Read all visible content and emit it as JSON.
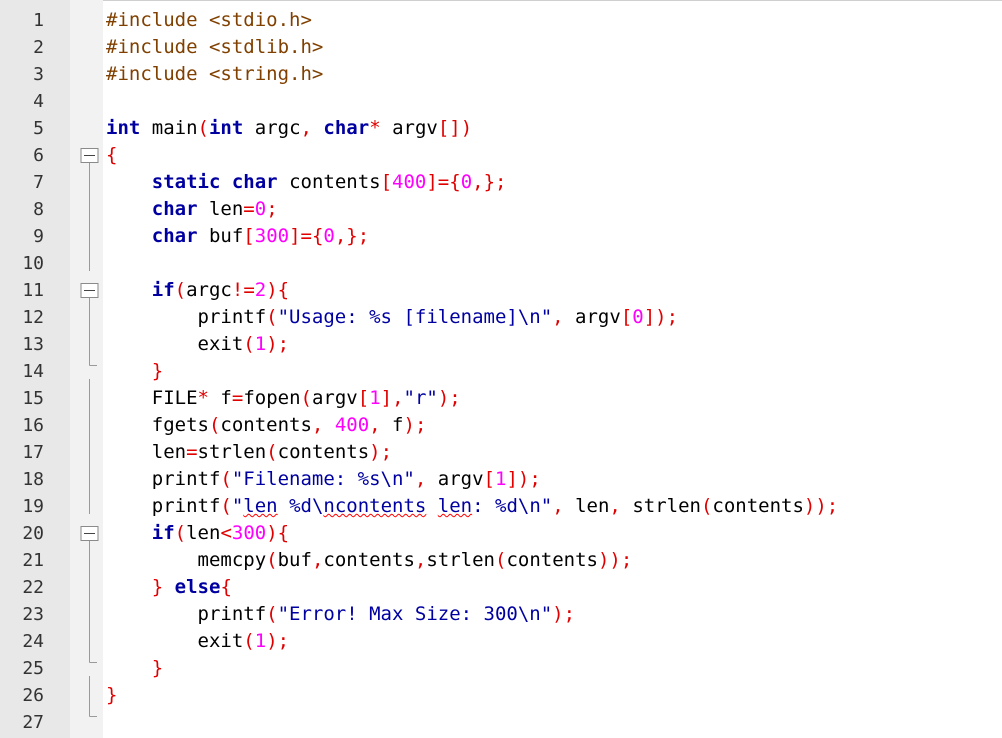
{
  "editor": {
    "lines": [
      {
        "n": "1",
        "fold": null,
        "tokens": [
          [
            "pp",
            "#include <stdio.h>"
          ]
        ]
      },
      {
        "n": "2",
        "fold": null,
        "tokens": [
          [
            "pp",
            "#include <stdlib.h>"
          ]
        ]
      },
      {
        "n": "3",
        "fold": null,
        "tokens": [
          [
            "pp",
            "#include <string.h>"
          ]
        ]
      },
      {
        "n": "4",
        "fold": null,
        "tokens": []
      },
      {
        "n": "5",
        "fold": null,
        "tokens": [
          [
            "kw",
            "int"
          ],
          [
            "id",
            " main"
          ],
          [
            "op",
            "("
          ],
          [
            "kw",
            "int"
          ],
          [
            "id",
            " argc"
          ],
          [
            "op",
            ","
          ],
          [
            "id",
            " "
          ],
          [
            "kw",
            "char"
          ],
          [
            "op",
            "*"
          ],
          [
            "id",
            " argv"
          ],
          [
            "op",
            "[])"
          ]
        ]
      },
      {
        "n": "6",
        "fold": "open",
        "tokens": [
          [
            "op",
            "{"
          ]
        ]
      },
      {
        "n": "7",
        "fold": "line",
        "tokens": [
          [
            "id",
            "    "
          ],
          [
            "kw",
            "static"
          ],
          [
            "id",
            " "
          ],
          [
            "kw",
            "char"
          ],
          [
            "id",
            " contents"
          ],
          [
            "op",
            "["
          ],
          [
            "num",
            "400"
          ],
          [
            "op",
            "]={"
          ],
          [
            "num",
            "0"
          ],
          [
            "op",
            ",};"
          ]
        ]
      },
      {
        "n": "8",
        "fold": "line",
        "tokens": [
          [
            "id",
            "    "
          ],
          [
            "kw",
            "char"
          ],
          [
            "id",
            " len"
          ],
          [
            "op",
            "="
          ],
          [
            "num",
            "0"
          ],
          [
            "op",
            ";"
          ]
        ]
      },
      {
        "n": "9",
        "fold": "line",
        "tokens": [
          [
            "id",
            "    "
          ],
          [
            "kw",
            "char"
          ],
          [
            "id",
            " buf"
          ],
          [
            "op",
            "["
          ],
          [
            "num",
            "300"
          ],
          [
            "op",
            "]={"
          ],
          [
            "num",
            "0"
          ],
          [
            "op",
            ",};"
          ]
        ]
      },
      {
        "n": "10",
        "fold": "line",
        "tokens": []
      },
      {
        "n": "11",
        "fold": "open",
        "tokens": [
          [
            "id",
            "    "
          ],
          [
            "kw",
            "if"
          ],
          [
            "op",
            "("
          ],
          [
            "id",
            "argc"
          ],
          [
            "op",
            "!="
          ],
          [
            "num",
            "2"
          ],
          [
            "op",
            ")"
          ],
          [
            "op",
            "{"
          ]
        ]
      },
      {
        "n": "12",
        "fold": "line",
        "tokens": [
          [
            "id",
            "        printf"
          ],
          [
            "op",
            "("
          ],
          [
            "str",
            "\"Usage: %s [filename]\\n\""
          ],
          [
            "op",
            ","
          ],
          [
            "id",
            " argv"
          ],
          [
            "op",
            "["
          ],
          [
            "num",
            "0"
          ],
          [
            "op",
            "]);"
          ]
        ]
      },
      {
        "n": "13",
        "fold": "line",
        "tokens": [
          [
            "id",
            "        exit"
          ],
          [
            "op",
            "("
          ],
          [
            "num",
            "1"
          ],
          [
            "op",
            ");"
          ]
        ]
      },
      {
        "n": "14",
        "fold": "end",
        "tokens": [
          [
            "id",
            "    "
          ],
          [
            "op",
            "}"
          ]
        ]
      },
      {
        "n": "15",
        "fold": "line",
        "tokens": [
          [
            "id",
            "    FILE"
          ],
          [
            "op",
            "*"
          ],
          [
            "id",
            " f"
          ],
          [
            "op",
            "="
          ],
          [
            "id",
            "fopen"
          ],
          [
            "op",
            "("
          ],
          [
            "id",
            "argv"
          ],
          [
            "op",
            "["
          ],
          [
            "num",
            "1"
          ],
          [
            "op",
            "],"
          ],
          [
            "str",
            "\"r\""
          ],
          [
            "op",
            ");"
          ]
        ]
      },
      {
        "n": "16",
        "fold": "line",
        "tokens": [
          [
            "id",
            "    fgets"
          ],
          [
            "op",
            "("
          ],
          [
            "id",
            "contents"
          ],
          [
            "op",
            ","
          ],
          [
            "id",
            " "
          ],
          [
            "num",
            "400"
          ],
          [
            "op",
            ","
          ],
          [
            "id",
            " f"
          ],
          [
            "op",
            ");"
          ]
        ]
      },
      {
        "n": "17",
        "fold": "line",
        "tokens": [
          [
            "id",
            "    len"
          ],
          [
            "op",
            "="
          ],
          [
            "id",
            "strlen"
          ],
          [
            "op",
            "("
          ],
          [
            "id",
            "contents"
          ],
          [
            "op",
            ");"
          ]
        ]
      },
      {
        "n": "18",
        "fold": "line",
        "tokens": [
          [
            "id",
            "    printf"
          ],
          [
            "op",
            "("
          ],
          [
            "str",
            "\"Filename: %s\\n\""
          ],
          [
            "op",
            ","
          ],
          [
            "id",
            " argv"
          ],
          [
            "op",
            "["
          ],
          [
            "num",
            "1"
          ],
          [
            "op",
            "]);"
          ]
        ]
      },
      {
        "n": "19",
        "fold": "line",
        "tokens": [
          [
            "id",
            "    printf"
          ],
          [
            "op",
            "("
          ],
          [
            "str",
            "\""
          ],
          [
            "sq",
            "len"
          ],
          [
            "str",
            " %d\\"
          ],
          [
            "sq",
            "ncontents"
          ],
          [
            "str",
            " "
          ],
          [
            "sq",
            "len"
          ],
          [
            "str",
            ": %d\\n\""
          ],
          [
            "op",
            ","
          ],
          [
            "id",
            " len"
          ],
          [
            "op",
            ","
          ],
          [
            "id",
            " strlen"
          ],
          [
            "op",
            "("
          ],
          [
            "id",
            "contents"
          ],
          [
            "op",
            "));"
          ]
        ]
      },
      {
        "n": "20",
        "fold": "open",
        "tokens": [
          [
            "id",
            "    "
          ],
          [
            "kw",
            "if"
          ],
          [
            "op",
            "("
          ],
          [
            "id",
            "len"
          ],
          [
            "op",
            "<"
          ],
          [
            "num",
            "300"
          ],
          [
            "op",
            ")"
          ],
          [
            "op",
            "{"
          ]
        ]
      },
      {
        "n": "21",
        "fold": "line",
        "tokens": [
          [
            "id",
            "        memcpy"
          ],
          [
            "op",
            "("
          ],
          [
            "id",
            "buf"
          ],
          [
            "op",
            ","
          ],
          [
            "id",
            "contents"
          ],
          [
            "op",
            ","
          ],
          [
            "id",
            "strlen"
          ],
          [
            "op",
            "("
          ],
          [
            "id",
            "contents"
          ],
          [
            "op",
            "));"
          ]
        ]
      },
      {
        "n": "22",
        "fold": "line",
        "tokens": [
          [
            "id",
            "    "
          ],
          [
            "op",
            "}"
          ],
          [
            "id",
            " "
          ],
          [
            "kw",
            "else"
          ],
          [
            "op",
            "{"
          ]
        ]
      },
      {
        "n": "23",
        "fold": "line",
        "tokens": [
          [
            "id",
            "        printf"
          ],
          [
            "op",
            "("
          ],
          [
            "str",
            "\"Error! Max Size: 300\\n\""
          ],
          [
            "op",
            ");"
          ]
        ]
      },
      {
        "n": "24",
        "fold": "line",
        "tokens": [
          [
            "id",
            "        exit"
          ],
          [
            "op",
            "("
          ],
          [
            "num",
            "1"
          ],
          [
            "op",
            ");"
          ]
        ]
      },
      {
        "n": "25",
        "fold": "end",
        "tokens": [
          [
            "id",
            "    "
          ],
          [
            "op",
            "}"
          ]
        ]
      },
      {
        "n": "26",
        "fold": "line",
        "tokens": [
          [
            "op",
            "}"
          ]
        ]
      },
      {
        "n": "27",
        "fold": "end",
        "tokens": []
      }
    ]
  },
  "colors": {
    "preprocessor": "#804000",
    "keyword": "#0000a0",
    "operator": "#e00000",
    "number": "#ff00ff",
    "string": "#0000a0",
    "gutter": "#e8e8e8",
    "fold_margin": "#f2f2f2"
  }
}
